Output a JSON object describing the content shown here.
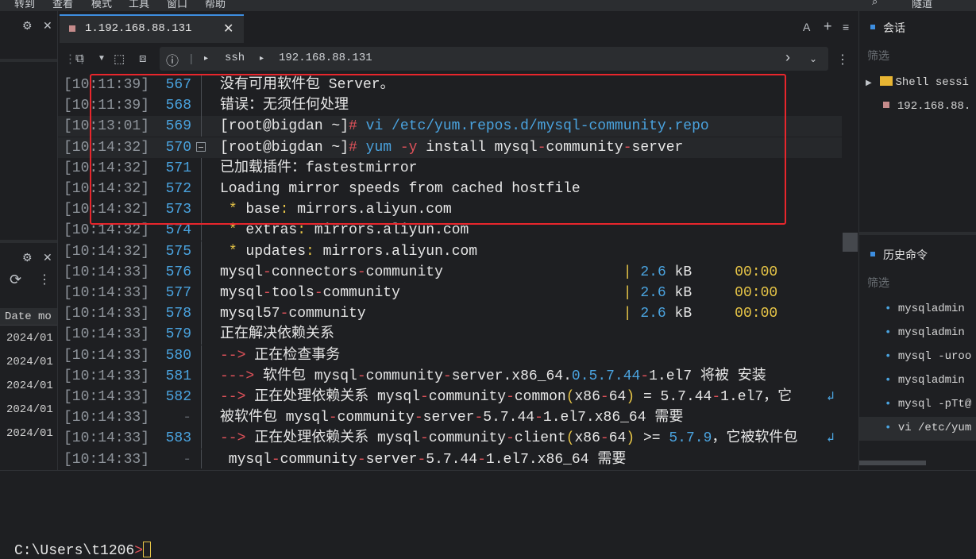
{
  "menu": [
    "转到",
    "查看",
    "模式",
    "工具",
    "窗口",
    "帮助"
  ],
  "menu_right": [
    "隧道"
  ],
  "tab": {
    "title": "1.192.168.88.131",
    "close": "✕"
  },
  "tab_tools": {
    "a": "A",
    "plus": "+",
    "menu": "≡"
  },
  "address": {
    "protocol": "ssh",
    "host": "192.168.88.131"
  },
  "left_table": {
    "column": "Date mo",
    "rows": [
      "2024/01",
      "2024/01",
      "2024/01",
      "2024/01",
      "2024/01"
    ]
  },
  "terminal": {
    "lines": [
      {
        "ts": "[10:11:39]",
        "no": "567",
        "segs": [
          {
            "t": "没有可用软件包 Server。"
          }
        ]
      },
      {
        "ts": "[10:11:39]",
        "no": "568",
        "segs": [
          {
            "t": "错误：无须任何处理"
          }
        ]
      },
      {
        "ts": "[10:13:01]",
        "no": "569",
        "hl": true,
        "segs": [
          {
            "t": "[root@bigdan ~]"
          },
          {
            "t": "#",
            "c": "red"
          },
          {
            "t": " vi /etc/yum.repos.d/mysql-community.repo",
            "c": "blue"
          }
        ]
      },
      {
        "ts": "[10:14:32]",
        "no": "570",
        "fold": true,
        "hl": true,
        "segs": [
          {
            "t": "[root@bigdan ~]"
          },
          {
            "t": "#",
            "c": "red"
          },
          {
            "t": " yum ",
            "c": "blue"
          },
          {
            "t": "-y",
            "c": "red"
          },
          {
            "t": " install mysql"
          },
          {
            "t": "-",
            "c": "red"
          },
          {
            "t": "community"
          },
          {
            "t": "-",
            "c": "red"
          },
          {
            "t": "server"
          }
        ]
      },
      {
        "ts": "[10:14:32]",
        "no": "571",
        "segs": [
          {
            "t": "已加载插件：fastestmirror"
          }
        ]
      },
      {
        "ts": "[10:14:32]",
        "no": "572",
        "segs": [
          {
            "t": "Loading mirror speeds from cached hostfile"
          }
        ]
      },
      {
        "ts": "[10:14:32]",
        "no": "573",
        "segs": [
          {
            "t": " "
          },
          {
            "t": "*",
            "c": "amber"
          },
          {
            "t": " base"
          },
          {
            "t": ":",
            "c": "amber"
          },
          {
            "t": " mirrors.aliyun.com"
          }
        ]
      },
      {
        "ts": "[10:14:32]",
        "no": "574",
        "segs": [
          {
            "t": " "
          },
          {
            "t": "*",
            "c": "amber"
          },
          {
            "t": " extras"
          },
          {
            "t": ":",
            "c": "amber"
          },
          {
            "t": " mirrors.aliyun.com"
          }
        ]
      },
      {
        "ts": "[10:14:32]",
        "no": "575",
        "segs": [
          {
            "t": " "
          },
          {
            "t": "*",
            "c": "amber"
          },
          {
            "t": " updates"
          },
          {
            "t": ":",
            "c": "amber"
          },
          {
            "t": " mirrors.aliyun.com"
          }
        ]
      },
      {
        "ts": "[10:14:33]",
        "no": "576",
        "segs": [
          {
            "t": "mysql"
          },
          {
            "t": "-",
            "c": "red"
          },
          {
            "t": "connectors"
          },
          {
            "t": "-",
            "c": "red"
          },
          {
            "t": "community                     "
          },
          {
            "t": "|",
            "c": "amber"
          },
          {
            "t": " 2.6",
            "c": "blue"
          },
          {
            "t": " kB     "
          },
          {
            "t": "00:00",
            "c": "amber"
          }
        ]
      },
      {
        "ts": "[10:14:33]",
        "no": "577",
        "segs": [
          {
            "t": "mysql"
          },
          {
            "t": "-",
            "c": "red"
          },
          {
            "t": "tools"
          },
          {
            "t": "-",
            "c": "red"
          },
          {
            "t": "community                          "
          },
          {
            "t": "|",
            "c": "amber"
          },
          {
            "t": " 2.6",
            "c": "blue"
          },
          {
            "t": " kB     "
          },
          {
            "t": "00:00",
            "c": "amber"
          }
        ]
      },
      {
        "ts": "[10:14:33]",
        "no": "578",
        "segs": [
          {
            "t": "mysql57"
          },
          {
            "t": "-",
            "c": "red"
          },
          {
            "t": "community                              "
          },
          {
            "t": "|",
            "c": "amber"
          },
          {
            "t": " 2.6",
            "c": "blue"
          },
          {
            "t": " kB     "
          },
          {
            "t": "00:00",
            "c": "amber"
          }
        ]
      },
      {
        "ts": "[10:14:33]",
        "no": "579",
        "segs": [
          {
            "t": "正在解决依赖关系"
          }
        ]
      },
      {
        "ts": "[10:14:33]",
        "no": "580",
        "segs": [
          {
            "t": "-->",
            "c": "red"
          },
          {
            "t": " 正在检查事务"
          }
        ]
      },
      {
        "ts": "[10:14:33]",
        "no": "581",
        "segs": [
          {
            "t": "--->",
            "c": "red"
          },
          {
            "t": " 软件包 mysql"
          },
          {
            "t": "-",
            "c": "red"
          },
          {
            "t": "community"
          },
          {
            "t": "-",
            "c": "red"
          },
          {
            "t": "server.x86_64."
          },
          {
            "t": "0.5.7.44",
            "c": "blue"
          },
          {
            "t": "-",
            "c": "red"
          },
          {
            "t": "1.el7 将被 安装"
          }
        ]
      },
      {
        "ts": "[10:14:33]",
        "no": "582",
        "wrap": true,
        "segs": [
          {
            "t": "-->",
            "c": "red"
          },
          {
            "t": " 正在处理依赖关系 mysql"
          },
          {
            "t": "-",
            "c": "red"
          },
          {
            "t": "community"
          },
          {
            "t": "-",
            "c": "red"
          },
          {
            "t": "common"
          },
          {
            "t": "(",
            "c": "amber"
          },
          {
            "t": "x86"
          },
          {
            "t": "-",
            "c": "red"
          },
          {
            "t": "64"
          },
          {
            "t": ")",
            "c": "amber"
          },
          {
            "t": " = 5.7.44"
          },
          {
            "t": "-",
            "c": "red"
          },
          {
            "t": "1.el7，它"
          }
        ]
      },
      {
        "ts": "[10:14:33]",
        "no": "-",
        "dash": true,
        "segs": [
          {
            "t": "被软件包 mysql"
          },
          {
            "t": "-",
            "c": "red"
          },
          {
            "t": "community"
          },
          {
            "t": "-",
            "c": "red"
          },
          {
            "t": "server"
          },
          {
            "t": "-",
            "c": "red"
          },
          {
            "t": "5.7.44"
          },
          {
            "t": "-",
            "c": "red"
          },
          {
            "t": "1.el7.x86_64 需要"
          }
        ]
      },
      {
        "ts": "[10:14:33]",
        "no": "583",
        "wrap": true,
        "segs": [
          {
            "t": "-->",
            "c": "red"
          },
          {
            "t": " 正在处理依赖关系 mysql"
          },
          {
            "t": "-",
            "c": "red"
          },
          {
            "t": "community"
          },
          {
            "t": "-",
            "c": "red"
          },
          {
            "t": "client"
          },
          {
            "t": "(",
            "c": "amber"
          },
          {
            "t": "x86"
          },
          {
            "t": "-",
            "c": "red"
          },
          {
            "t": "64"
          },
          {
            "t": ")",
            "c": "amber"
          },
          {
            "t": " >= "
          },
          {
            "t": "5.7.9",
            "c": "blue"
          },
          {
            "t": "，它被软件包"
          }
        ]
      },
      {
        "ts": "[10:14:33]",
        "no": "-",
        "dash": true,
        "segs": [
          {
            "t": " mysql"
          },
          {
            "t": "-",
            "c": "red"
          },
          {
            "t": "community"
          },
          {
            "t": "-",
            "c": "red"
          },
          {
            "t": "server"
          },
          {
            "t": "-",
            "c": "red"
          },
          {
            "t": "5.7.44"
          },
          {
            "t": "-",
            "c": "red"
          },
          {
            "t": "1.el7.x86_64 需要"
          }
        ]
      }
    ]
  },
  "sessions": {
    "title": "会话",
    "filter": "筛选",
    "folder": "Shell sessi",
    "item": "192.168.88."
  },
  "history": {
    "title": "历史命令",
    "filter": "筛选",
    "items": [
      "mysqladmin",
      "mysqladmin",
      "mysql -uroo",
      "mysqladmin",
      "mysql -pTt@",
      "vi /etc/yum"
    ]
  },
  "local_prompt": {
    "path": "C:\\Users\\t1206",
    "sym": ">"
  },
  "colors": {
    "accent": "#3d8ee0",
    "highlight_box": "#e8262c"
  }
}
